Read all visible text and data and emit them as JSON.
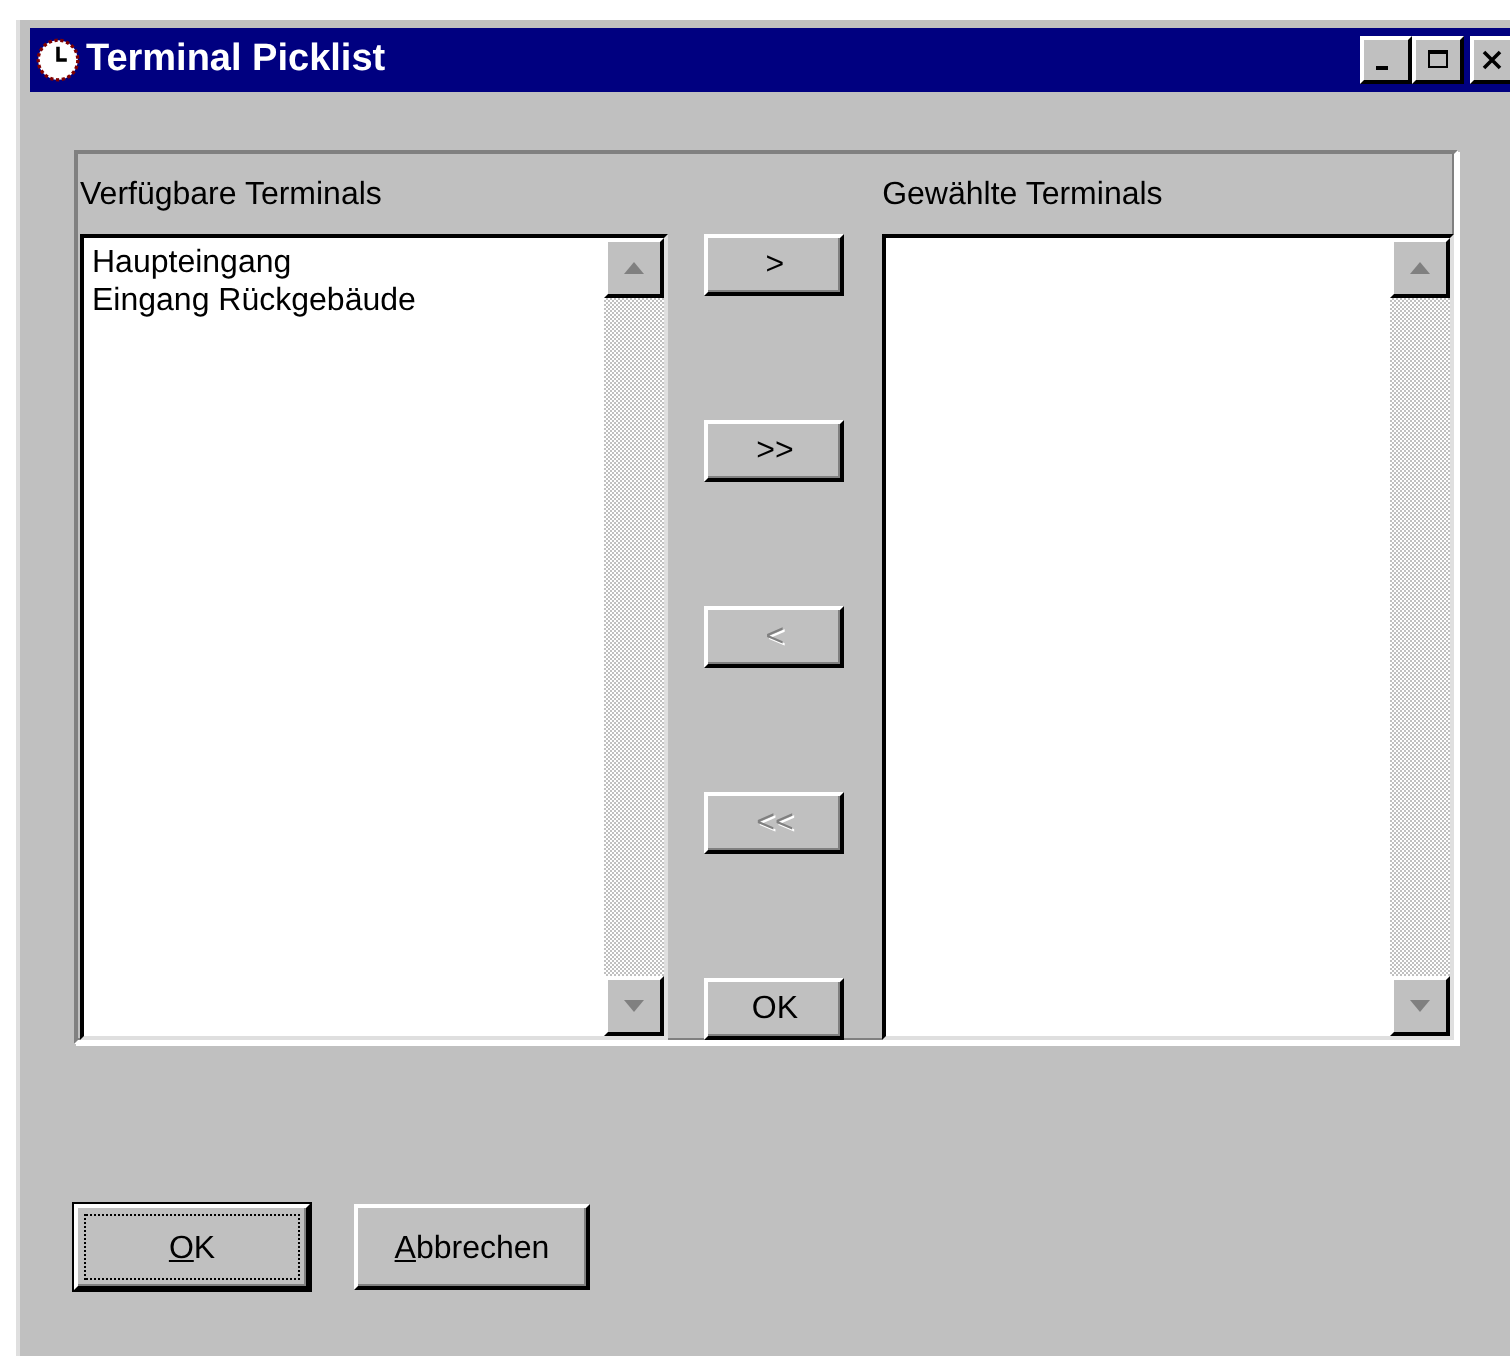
{
  "window": {
    "title": "Terminal Picklist"
  },
  "available": {
    "label": "Verfügbare Terminals",
    "items": [
      "Haupteingang",
      "Eingang Rückgebäude"
    ]
  },
  "chosen": {
    "label": "Gewählte Terminals"
  },
  "transfer_buttons": [
    {
      "label": ">",
      "disabled": false
    },
    {
      "label": ">>",
      "disabled": false
    },
    {
      "label": "<",
      "disabled": true
    },
    {
      "label": "<<",
      "disabled": true
    },
    {
      "label": "OK",
      "disabled": false
    }
  ],
  "buttons": [
    {
      "label": "OK",
      "accelerator": true,
      "default": true
    },
    {
      "label": "Abbrechen",
      "accelerator": true,
      "default": false
    }
  ]
}
